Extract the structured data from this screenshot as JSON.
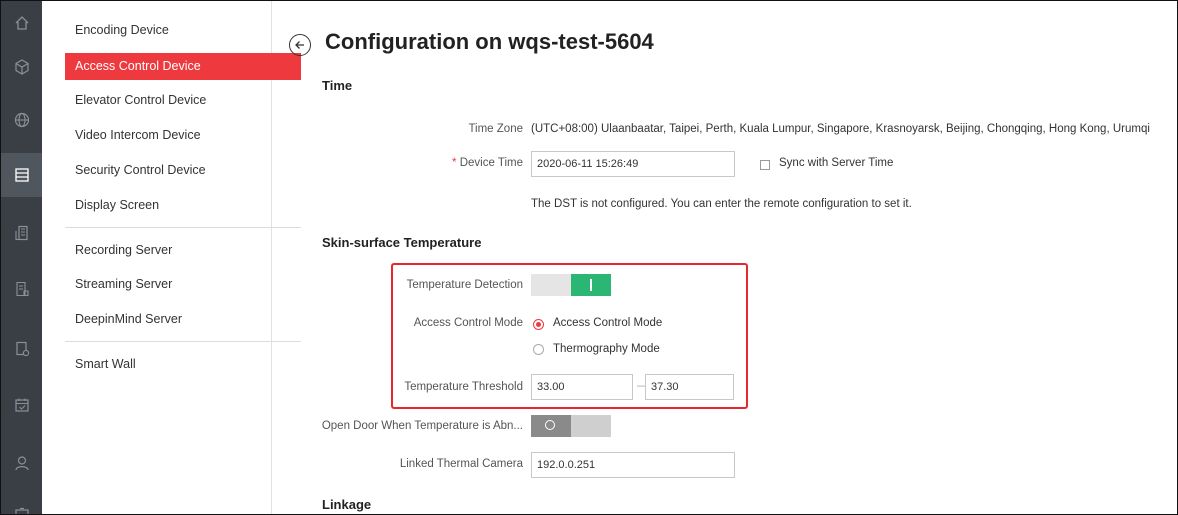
{
  "rail": {
    "icons": [
      "home-icon",
      "cube-icon",
      "globe-icon",
      "device-list-icon",
      "building-icon",
      "report-icon",
      "log-icon",
      "calendar-icon",
      "person-icon",
      "id-card-icon"
    ]
  },
  "nav": {
    "items": [
      {
        "label": "Encoding Device"
      },
      {
        "label": "Access Control Device"
      },
      {
        "label": "Elevator Control Device"
      },
      {
        "label": "Video Intercom Device"
      },
      {
        "label": "Security Control Device"
      },
      {
        "label": "Display Screen"
      },
      {
        "label": "Recording Server"
      },
      {
        "label": "Streaming Server"
      },
      {
        "label": "DeepinMind Server"
      },
      {
        "label": "Smart Wall"
      }
    ],
    "active_index": 1
  },
  "page": {
    "title": "Configuration on wqs-test-5604"
  },
  "time": {
    "section_title": "Time",
    "timezone_label": "Time Zone",
    "timezone_value": "(UTC+08:00) Ulaanbaatar, Taipei, Perth, Kuala Lumpur, Singapore, Krasnoyarsk, Beijing, Chongqing, Hong Kong, Urumqi",
    "device_time_required": "*",
    "device_time_label": "Device Time",
    "device_time_value": "2020-06-11 15:26:49",
    "sync_label": "Sync with Server Time",
    "sync_checked": false,
    "dst_note": "The DST is not configured. You can enter the remote configuration to set it."
  },
  "skin": {
    "section_title": "Skin-surface Temperature",
    "detection_label": "Temperature Detection",
    "detection_on": true,
    "mode_label": "Access Control Mode",
    "mode_options": [
      {
        "label": "Access Control Mode",
        "selected": true
      },
      {
        "label": "Thermography Mode",
        "selected": false
      }
    ],
    "threshold_label": "Temperature Threshold",
    "threshold_low": "33.00",
    "threshold_sep": "—",
    "threshold_high": "37.30",
    "open_door_label": "Open Door When Temperature is Abn...",
    "open_door_on": false,
    "thermal_label": "Linked Thermal Camera",
    "thermal_value": "192.0.0.251"
  },
  "linkage": {
    "section_title": "Linkage"
  },
  "colors": {
    "accent": "#ee3a3f",
    "toggle_on": "#2bb673",
    "toggle_off": "#cfcfcf",
    "rail_bg": "#3a3f46",
    "highlight": "#e8272d"
  }
}
